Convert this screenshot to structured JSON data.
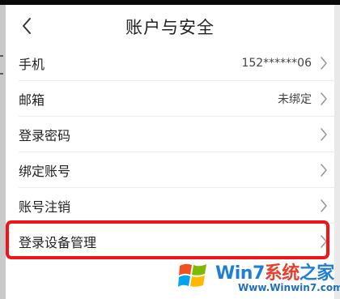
{
  "header": {
    "title": "账户与安全"
  },
  "rows": [
    {
      "label": "手机",
      "value": "152******06"
    },
    {
      "label": "邮箱",
      "value": "未绑定"
    },
    {
      "label": "登录密码",
      "value": ""
    },
    {
      "label": "绑定账号",
      "value": ""
    },
    {
      "label": "账号注销",
      "value": ""
    },
    {
      "label": "登录设备管理",
      "value": ""
    }
  ],
  "icons": {
    "back": "chevron-left-icon",
    "row_arrow": "chevron-right-icon"
  },
  "highlight": {
    "target": "登录设备管理",
    "color": "#f2141a"
  },
  "watermark": {
    "brand_part1": "Win7",
    "brand_part2": "系统",
    "brand_part3": "之家",
    "url": "Www.Winwin7.com"
  },
  "colors": {
    "accent_red": "#f2141a",
    "watermark_blue": "#1f7fd6"
  }
}
